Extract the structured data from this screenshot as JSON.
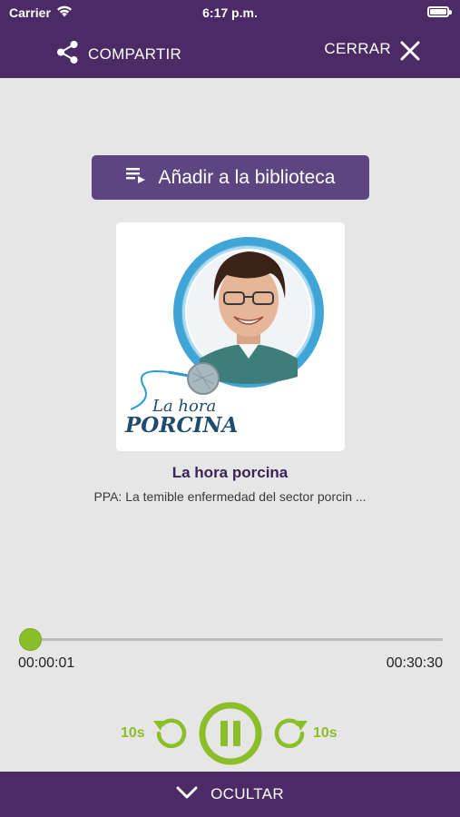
{
  "status_bar": {
    "carrier": "Carrier",
    "time": "6:17 p.m.",
    "icons": [
      "wifi-icon",
      "battery-icon"
    ]
  },
  "header": {
    "share_label": "COMPARTIR",
    "close_label": "CERRAR",
    "share_icon": "share-icon",
    "close_icon": "close-icon",
    "bar_color": "#4b2a66"
  },
  "library_button": {
    "label": "Añadir a la biblioteca",
    "icon": "playlist-add-icon",
    "color": "#5c4580"
  },
  "artwork": {
    "logo_line1": "La hora",
    "logo_line2": "PORCINA",
    "accent_color": "#2a9bd2"
  },
  "track": {
    "title": "La hora porcina",
    "subtitle": "PPA: La temible enfermedad del sector porcin ..."
  },
  "player": {
    "elapsed": "00:00:01",
    "total": "00:30:30",
    "progress": 0.0005,
    "skip_back_label": "10s",
    "skip_forward_label": "10s",
    "state_icon": "pause-icon",
    "accent_color": "#8bbf2a"
  },
  "footer": {
    "label": "OCULTAR",
    "icon": "chevron-down-icon"
  }
}
